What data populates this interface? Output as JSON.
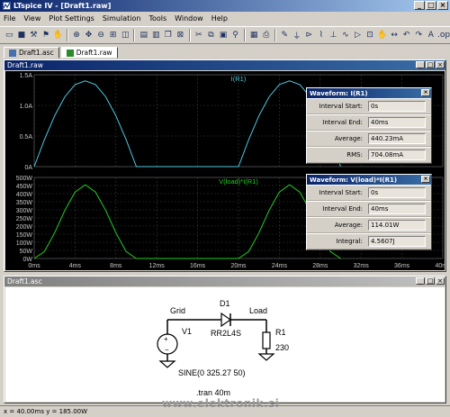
{
  "app": {
    "title": "LTspice IV - [Draft1.raw]"
  },
  "menu": [
    "File",
    "View",
    "Plot Settings",
    "Simulation",
    "Tools",
    "Window",
    "Help"
  ],
  "tabs": [
    {
      "label": "Draft1.asc",
      "active": false
    },
    {
      "label": "Draft1.raw",
      "active": true
    }
  ],
  "waveform_window": {
    "title": "Draft1.raw"
  },
  "schematic_window": {
    "title": "Draft1.asc"
  },
  "measure_boxes": [
    {
      "title": "Waveform: I(R1)",
      "rows": [
        {
          "label": "Interval Start:",
          "value": "0s"
        },
        {
          "label": "Interval End:",
          "value": "40ms"
        },
        {
          "label": "Average:",
          "value": "440.23mA"
        },
        {
          "label": "RMS:",
          "value": "704.08mA"
        }
      ]
    },
    {
      "title": "Waveform: V(load)*I(R1)",
      "rows": [
        {
          "label": "Interval Start:",
          "value": "0s"
        },
        {
          "label": "Interval End:",
          "value": "40ms"
        },
        {
          "label": "Average:",
          "value": "114.01W"
        },
        {
          "label": "Integral:",
          "value": "4.5607J"
        }
      ]
    }
  ],
  "chart_data": [
    {
      "type": "line",
      "title": "I(R1)",
      "ylabel": "",
      "ylim": [
        0,
        1.5
      ],
      "yticks": [
        "1.5A",
        "1.0A",
        "0.5A",
        "0A"
      ],
      "xlim": [
        0,
        40
      ],
      "series": [
        {
          "name": "I(R1)",
          "color": "#4ec9e0",
          "x": [
            0,
            1,
            2,
            3,
            4,
            5,
            6,
            7,
            8,
            9,
            10,
            11,
            12,
            13,
            14,
            15,
            16,
            17,
            18,
            19,
            20,
            21,
            22,
            23,
            24,
            25,
            26,
            27,
            28,
            29,
            30
          ],
          "values": [
            0,
            0.44,
            0.83,
            1.14,
            1.34,
            1.4,
            1.34,
            1.14,
            0.83,
            0.44,
            0,
            0,
            0,
            0,
            0,
            0,
            0,
            0,
            0,
            0,
            0,
            0.44,
            0.83,
            1.14,
            1.34,
            1.4,
            1.34,
            1.14,
            0.83,
            0.44,
            0
          ]
        }
      ]
    },
    {
      "type": "line",
      "title": "V(load)*I(R1)",
      "ylabel": "",
      "ylim": [
        0,
        500
      ],
      "yticks": [
        "500W",
        "450W",
        "400W",
        "350W",
        "300W",
        "250W",
        "200W",
        "150W",
        "100W",
        "50W",
        "0W"
      ],
      "xlim": [
        0,
        40
      ],
      "xticks": [
        "0ms",
        "4ms",
        "8ms",
        "12ms",
        "16ms",
        "20ms",
        "24ms",
        "28ms",
        "32ms",
        "36ms",
        "40ms"
      ],
      "series": [
        {
          "name": "V(load)*I(R1)",
          "color": "#22d022",
          "x": [
            0,
            1,
            2,
            3,
            4,
            5,
            6,
            7,
            8,
            9,
            10,
            11,
            12,
            13,
            14,
            15,
            16,
            17,
            18,
            19,
            20,
            21,
            22,
            23,
            24,
            25,
            26,
            27,
            28,
            29,
            30
          ],
          "values": [
            0,
            43,
            158,
            297,
            410,
            455,
            410,
            297,
            158,
            43,
            0,
            0,
            0,
            0,
            0,
            0,
            0,
            0,
            0,
            0,
            0,
            43,
            158,
            297,
            410,
            455,
            410,
            297,
            158,
            43,
            0
          ]
        }
      ]
    }
  ],
  "schematic": {
    "labels": {
      "grid": "Grid",
      "load": "Load",
      "d1": "D1",
      "diode_model": "RR2L4S",
      "v1": "V1",
      "r1": "R1",
      "r1_value": "230",
      "source": "SINE(0 325.27 50)",
      "directive": ".tran 40m"
    }
  },
  "status": {
    "text": "x = 40.00ms    y = 185.00W"
  },
  "watermark": "www.elektronik.si",
  "colors": {
    "accent": "#0a246a",
    "trace_current": "#4ec9e0",
    "trace_power": "#22d022",
    "plot_bg": "#000000"
  }
}
